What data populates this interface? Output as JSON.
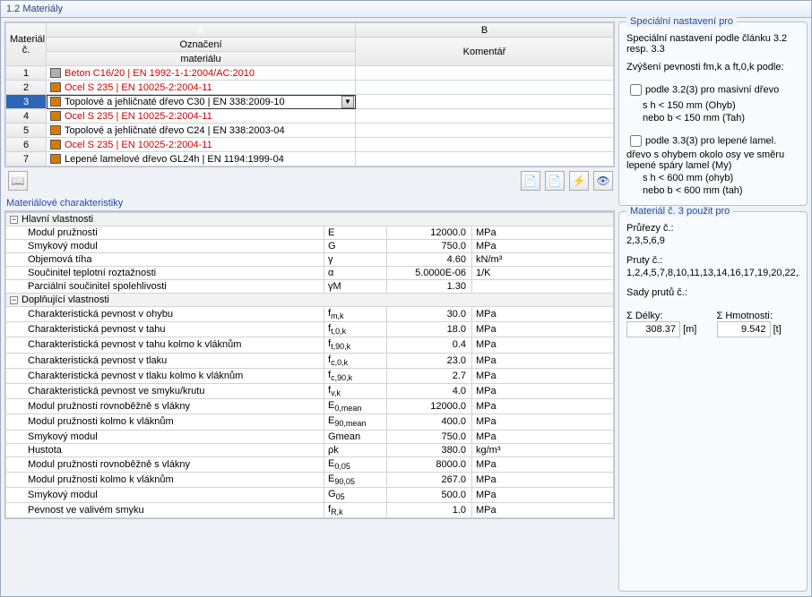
{
  "window": {
    "title": "1.2 Materiály"
  },
  "materials": {
    "rowHeader": "Materiál\nč.",
    "colA_letter": "A",
    "colB_letter": "B",
    "colA_title1": "Označení",
    "colA_title2": "materiálu",
    "colB_title": "Komentář",
    "rows": [
      {
        "num": "1",
        "color": "#b0b0b0",
        "label": "Beton C16/20 | EN 1992-1-1:2004/AC:2010",
        "red": true
      },
      {
        "num": "2",
        "color": "#d97a00",
        "label": "Ocel S 235 | EN 10025-2:2004-11",
        "red": true
      },
      {
        "num": "3",
        "color": "#d97a00",
        "label": "Topolové a jehličnaté dřevo C30 | EN 338:2009-10",
        "red": false,
        "selected": true
      },
      {
        "num": "4",
        "color": "#d97a00",
        "label": "Ocel S 235 | EN 10025-2:2004-11",
        "red": true
      },
      {
        "num": "5",
        "color": "#d97a00",
        "label": "Topolové a jehličnaté dřevo C24 | EN 338:2003-04",
        "red": false
      },
      {
        "num": "6",
        "color": "#d97a00",
        "label": "Ocel S 235 | EN 10025-2:2004-11",
        "red": true
      },
      {
        "num": "7",
        "color": "#d97a00",
        "label": "Lepené lamelové dřevo GL24h | EN 1194:1999-04",
        "red": false
      }
    ]
  },
  "char": {
    "title": "Materiálové charakteristiky",
    "group1": "Hlavní vlastnosti",
    "group2": "Doplňující vlastnosti",
    "rows1": [
      {
        "name": "Modul pružnosti",
        "sym": "E",
        "val": "12000.0",
        "unit": "MPa"
      },
      {
        "name": "Smykový modul",
        "sym": "G",
        "val": "750.0",
        "unit": "MPa"
      },
      {
        "name": "Objemová tíha",
        "sym": "γ",
        "val": "4.60",
        "unit": "kN/m³"
      },
      {
        "name": "Součinitel teplotní roztažnosti",
        "sym": "α",
        "val": "5.0000E-06",
        "unit": "1/K"
      },
      {
        "name": "Parciální součinitel spolehlivosti",
        "sym": "γM",
        "val": "1.30",
        "unit": ""
      }
    ],
    "rows2": [
      {
        "name": "Charakteristická pevnost v ohybu",
        "sym": "f m,k",
        "val": "30.0",
        "unit": "MPa"
      },
      {
        "name": "Charakteristická pevnost v tahu",
        "sym": "f t,0,k",
        "val": "18.0",
        "unit": "MPa"
      },
      {
        "name": "Charakteristická pevnost v tahu kolmo k vláknům",
        "sym": "f t,90,k",
        "val": "0.4",
        "unit": "MPa"
      },
      {
        "name": "Charakteristická pevnost v tlaku",
        "sym": "f c,0,k",
        "val": "23.0",
        "unit": "MPa"
      },
      {
        "name": "Charakteristická pevnost v tlaku kolmo k vláknům",
        "sym": "f c,90,k",
        "val": "2.7",
        "unit": "MPa"
      },
      {
        "name": "Charakteristická pevnost ve smyku/krutu",
        "sym": "f v,k",
        "val": "4.0",
        "unit": "MPa"
      },
      {
        "name": "Modul pružnosti rovnoběžně s vlákny",
        "sym": "E0,mean",
        "val": "12000.0",
        "unit": "MPa"
      },
      {
        "name": "Modul pružnosti kolmo k vláknům",
        "sym": "E90,mean",
        "val": "400.0",
        "unit": "MPa"
      },
      {
        "name": "Smykový modul",
        "sym": "Gmean",
        "val": "750.0",
        "unit": "MPa"
      },
      {
        "name": "Hustota",
        "sym": "ρk",
        "val": "380.0",
        "unit": "kg/m³"
      },
      {
        "name": "Modul pružnosti rovnoběžně s vlákny",
        "sym": "E0,05",
        "val": "8000.0",
        "unit": "MPa"
      },
      {
        "name": "Modul pružnosti kolmo k vláknům",
        "sym": "E90,05",
        "val": "267.0",
        "unit": "MPa"
      },
      {
        "name": "Smykový modul",
        "sym": "G05",
        "val": "500.0",
        "unit": "MPa"
      },
      {
        "name": "Pevnost ve valivém smyku",
        "sym": "f R,k",
        "val": "1.0",
        "unit": "MPa"
      }
    ]
  },
  "special": {
    "legend": "Speciální nastavení pro",
    "line1": "Speciální nastavení podle článku 3.2 resp. 3.3",
    "line2_a": "Zvýšení pevnosti f",
    "line2_sub1": "m,k",
    "line2_b": " a f",
    "line2_sub2": "t,0,k",
    "line2_c": " podle:",
    "opt1": "podle 3.2(3) pro masivní dřevo",
    "opt1a": "s h < 150 mm (Ohyb)",
    "opt1b": "nebo b < 150 mm (Tah)",
    "opt2": "podle 3.3(3) pro lepené lamel. dřevo s ohybem okolo osy ve směru lepené spáry lamel (My)",
    "opt2a": "s h < 600   mm (ohyb)",
    "opt2b": "nebo b < 600 mm (tah)"
  },
  "usage": {
    "legend": "Materiál č. 3 použit pro",
    "l1": "Průřezy č.:",
    "v1": "2,3,5,6,9",
    "l2": "Pruty č.:",
    "v2": "1,2,4,5,7,8,10,11,13,14,16,17,19,20,22,23",
    "l3": "Sady prutů č.:",
    "v3": "",
    "sum1l": "Σ Délky:",
    "sum1v": "308.37",
    "sum1u": "[m]",
    "sum2l": "Σ Hmotnosti:",
    "sum2v": "9.542",
    "sum2u": "[t]"
  },
  "icons": {
    "library": "📖",
    "exportGreen": "📄",
    "exportRed": "📄",
    "thunder": "⚡",
    "eye": "👁"
  }
}
